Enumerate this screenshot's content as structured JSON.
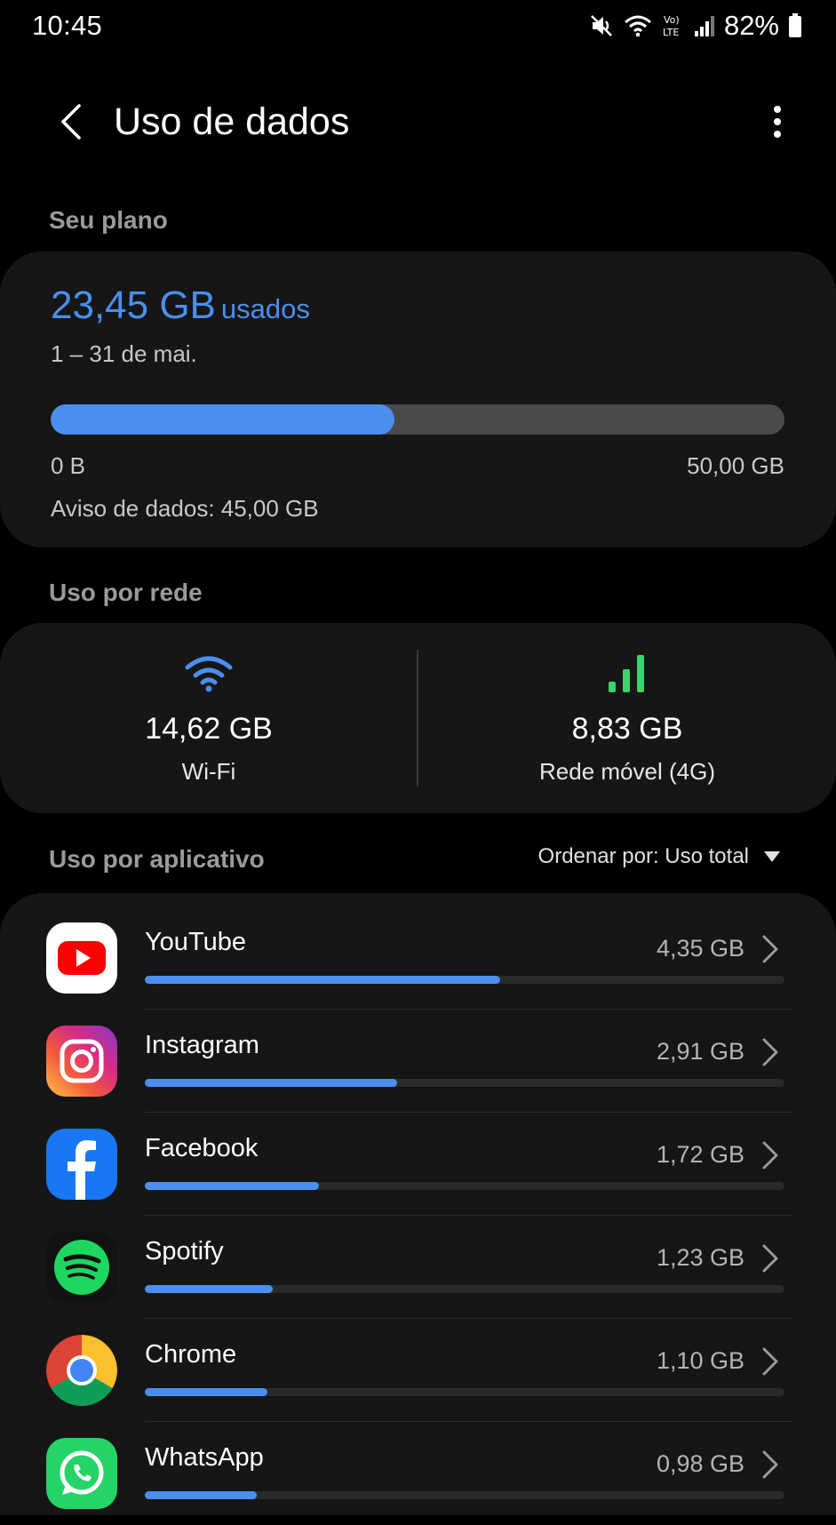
{
  "status_bar": {
    "time": "10:45",
    "battery": "82%",
    "icons": [
      "mute-icon",
      "wifi-icon",
      "volte-icon",
      "signal-icon",
      "battery-icon"
    ]
  },
  "app_bar": {
    "title": "Uso de dados",
    "back_icon": "back-arrow-icon",
    "more_icon": "more-vertical-icon"
  },
  "plan": {
    "section_title": "Seu plano",
    "used_value": "23,45 GB",
    "used_label": "usados",
    "period": "1 – 31 de mai.",
    "progress_fraction": 0.469,
    "min_label": "0 B",
    "max_label": "50,00 GB",
    "warning": "Aviso de dados: 45,00 GB"
  },
  "network": {
    "section_title": "Uso por rede",
    "wifi": {
      "value": "14,62 GB",
      "label": "Wi-Fi",
      "icon": "wifi-icon"
    },
    "mobile": {
      "value": "8,83 GB",
      "label": "Rede móvel (4G)",
      "icon": "cellular-signal-icon"
    }
  },
  "apps": {
    "section_title": "Uso por aplicativo",
    "sort_label": "Ordenar por: Uso total",
    "items": [
      {
        "name": "YouTube",
        "size": "4,35 GB",
        "fraction": 0.555
      },
      {
        "name": "Instagram",
        "size": "2,91 GB",
        "fraction": 0.395
      },
      {
        "name": "Facebook",
        "size": "1,72 GB",
        "fraction": 0.272
      },
      {
        "name": "Spotify",
        "size": "1,23 GB",
        "fraction": 0.2
      },
      {
        "name": "Chrome",
        "size": "1,10 GB",
        "fraction": 0.192
      },
      {
        "name": "WhatsApp",
        "size": "0,98 GB",
        "fraction": 0.175
      }
    ]
  },
  "colors": {
    "accent": "#4a8ff0",
    "mobile_signal": "#3dd26a",
    "card_background": "#161616",
    "page_background": "#000000"
  }
}
